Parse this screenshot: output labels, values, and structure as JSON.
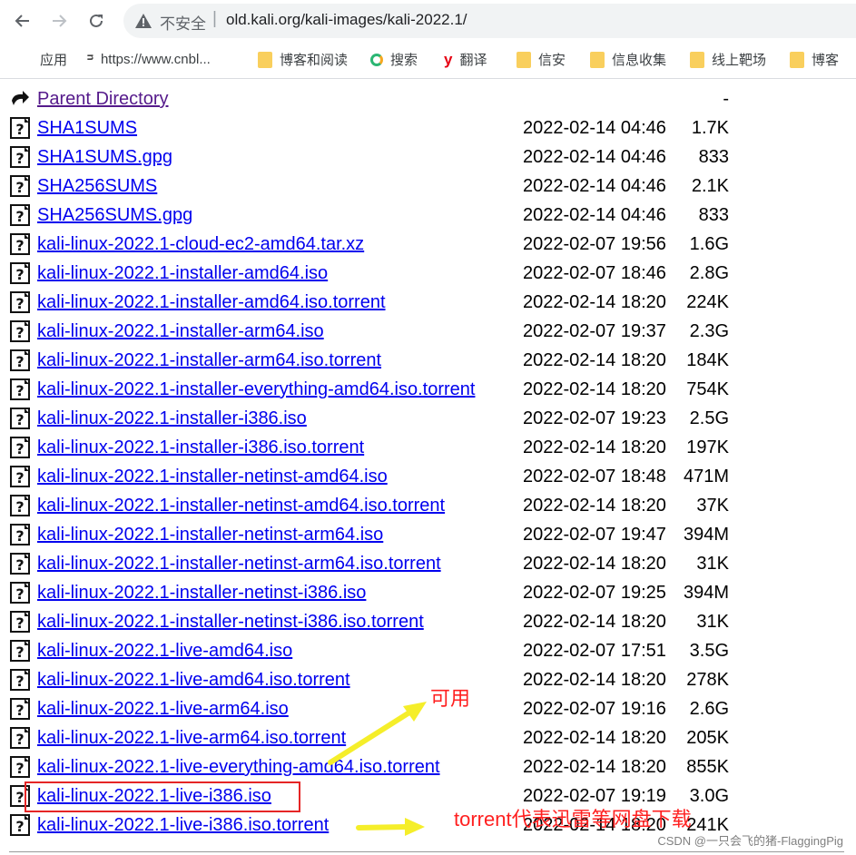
{
  "browser": {
    "url_warning": "不安全",
    "url_separator": "|",
    "url": "old.kali.org/kali-images/kali-2022.1/"
  },
  "bookmarks": [
    {
      "label": "应用",
      "icon": "apps-grid-icon"
    },
    {
      "label": "https://www.cnbl...",
      "icon": "cnblogs-icon"
    },
    {
      "label": "博客和阅读",
      "icon": "folder-icon"
    },
    {
      "label": "搜索",
      "icon": "search-engine-icon"
    },
    {
      "label": "翻译",
      "icon": "translate-icon"
    },
    {
      "label": "信安",
      "icon": "folder-icon"
    },
    {
      "label": "信息收集",
      "icon": "folder-icon"
    },
    {
      "label": "线上靶场",
      "icon": "folder-icon"
    },
    {
      "label": "博客",
      "icon": "folder-icon"
    }
  ],
  "listing": {
    "parent": {
      "name": "Parent Directory",
      "size": "-"
    },
    "files": [
      {
        "name": "SHA1SUMS",
        "date": "2022-02-14 04:46",
        "size": "1.7K"
      },
      {
        "name": "SHA1SUMS.gpg",
        "date": "2022-02-14 04:46",
        "size": "833"
      },
      {
        "name": "SHA256SUMS",
        "date": "2022-02-14 04:46",
        "size": "2.1K"
      },
      {
        "name": "SHA256SUMS.gpg",
        "date": "2022-02-14 04:46",
        "size": "833"
      },
      {
        "name": "kali-linux-2022.1-cloud-ec2-amd64.tar.xz",
        "date": "2022-02-07 19:56",
        "size": "1.6G"
      },
      {
        "name": "kali-linux-2022.1-installer-amd64.iso",
        "date": "2022-02-07 18:46",
        "size": "2.8G"
      },
      {
        "name": "kali-linux-2022.1-installer-amd64.iso.torrent",
        "date": "2022-02-14 18:20",
        "size": "224K"
      },
      {
        "name": "kali-linux-2022.1-installer-arm64.iso",
        "date": "2022-02-07 19:37",
        "size": "2.3G"
      },
      {
        "name": "kali-linux-2022.1-installer-arm64.iso.torrent",
        "date": "2022-02-14 18:20",
        "size": "184K"
      },
      {
        "name": "kali-linux-2022.1-installer-everything-amd64.iso.torrent",
        "date": "2022-02-14 18:20",
        "size": "754K"
      },
      {
        "name": "kali-linux-2022.1-installer-i386.iso",
        "date": "2022-02-07 19:23",
        "size": "2.5G"
      },
      {
        "name": "kali-linux-2022.1-installer-i386.iso.torrent",
        "date": "2022-02-14 18:20",
        "size": "197K"
      },
      {
        "name": "kali-linux-2022.1-installer-netinst-amd64.iso",
        "date": "2022-02-07 18:48",
        "size": "471M"
      },
      {
        "name": "kali-linux-2022.1-installer-netinst-amd64.iso.torrent",
        "date": "2022-02-14 18:20",
        "size": "37K"
      },
      {
        "name": "kali-linux-2022.1-installer-netinst-arm64.iso",
        "date": "2022-02-07 19:47",
        "size": "394M"
      },
      {
        "name": "kali-linux-2022.1-installer-netinst-arm64.iso.torrent",
        "date": "2022-02-14 18:20",
        "size": "31K"
      },
      {
        "name": "kali-linux-2022.1-installer-netinst-i386.iso",
        "date": "2022-02-07 19:25",
        "size": "394M"
      },
      {
        "name": "kali-linux-2022.1-installer-netinst-i386.iso.torrent",
        "date": "2022-02-14 18:20",
        "size": "31K"
      },
      {
        "name": "kali-linux-2022.1-live-amd64.iso",
        "date": "2022-02-07 17:51",
        "size": "3.5G"
      },
      {
        "name": "kali-linux-2022.1-live-amd64.iso.torrent",
        "date": "2022-02-14 18:20",
        "size": "278K"
      },
      {
        "name": "kali-linux-2022.1-live-arm64.iso",
        "date": "2022-02-07 19:16",
        "size": "2.6G"
      },
      {
        "name": "kali-linux-2022.1-live-arm64.iso.torrent",
        "date": "2022-02-14 18:20",
        "size": "205K"
      },
      {
        "name": "kali-linux-2022.1-live-everything-amd64.iso.torrent",
        "date": "2022-02-14 18:20",
        "size": "855K"
      },
      {
        "name": "kali-linux-2022.1-live-i386.iso",
        "date": "2022-02-07 19:19",
        "size": "3.0G"
      },
      {
        "name": "kali-linux-2022.1-live-i386.iso.torrent",
        "date": "2022-02-14 18:20",
        "size": "241K"
      }
    ]
  },
  "annotations": {
    "usable": "可用",
    "torrent_note": "torrent代表迅雷等网盘下载",
    "watermark": "CSDN @一只会飞的猪-FlaggingPig",
    "highlight_color": "#e52525",
    "arrow_color": "#f5ee2a"
  }
}
